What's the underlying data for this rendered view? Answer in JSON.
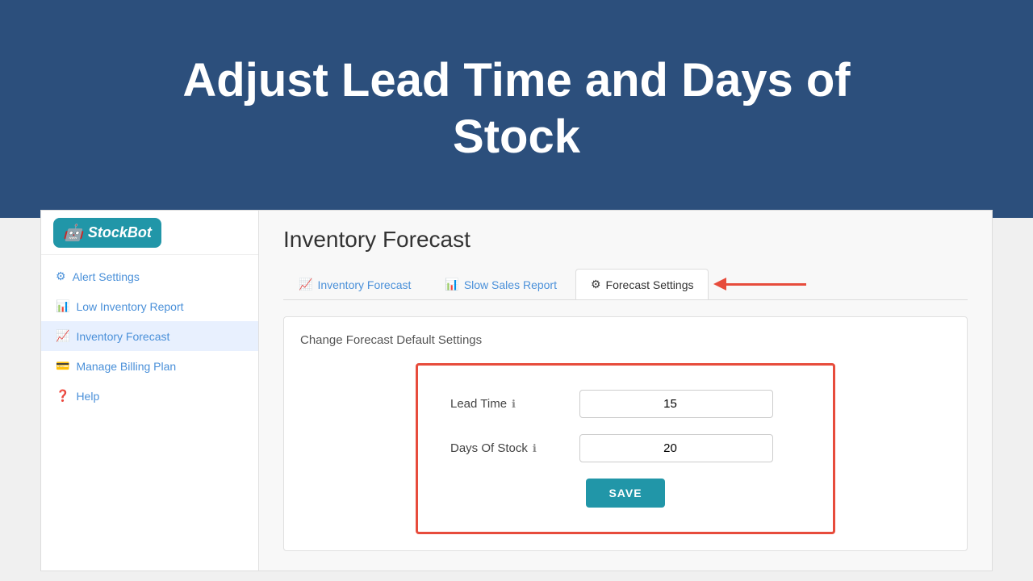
{
  "hero": {
    "title": "Adjust Lead Time and Days of Stock"
  },
  "sidebar": {
    "logo_text": "StockBot",
    "logo_icon": "🤖",
    "items": [
      {
        "id": "alert-settings",
        "label": "Alert Settings",
        "icon": "⚙",
        "active": false
      },
      {
        "id": "low-inventory-report",
        "label": "Low Inventory Report",
        "icon": "📊",
        "active": false
      },
      {
        "id": "inventory-forecast",
        "label": "Inventory Forecast",
        "icon": "📈",
        "active": true
      },
      {
        "id": "manage-billing-plan",
        "label": "Manage Billing Plan",
        "icon": "💳",
        "active": false
      },
      {
        "id": "help",
        "label": "Help",
        "icon": "❓",
        "active": false
      }
    ]
  },
  "main": {
    "page_title": "Inventory Forecast",
    "tabs": [
      {
        "id": "inventory-forecast-tab",
        "label": "Inventory Forecast",
        "icon": "📈",
        "active": false
      },
      {
        "id": "slow-sales-report-tab",
        "label": "Slow Sales Report",
        "icon": "📊",
        "active": false
      },
      {
        "id": "forecast-settings-tab",
        "label": "Forecast Settings",
        "icon": "⚙",
        "active": true
      }
    ],
    "settings_section_title": "Change Forecast Default Settings",
    "form": {
      "lead_time_label": "Lead Time",
      "lead_time_value": "15",
      "days_of_stock_label": "Days Of Stock",
      "days_of_stock_value": "20",
      "save_button_label": "SAVE"
    }
  }
}
